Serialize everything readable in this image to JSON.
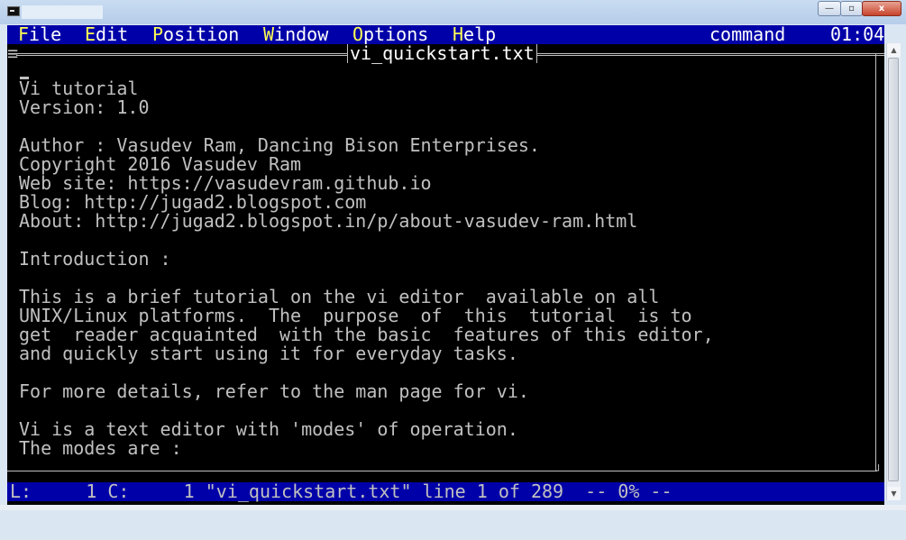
{
  "window": {
    "minimize_glyph": "—",
    "maximize_glyph": "▫",
    "close_glyph": "x"
  },
  "menubar": {
    "items": [
      {
        "hot": "F",
        "rest": "ile"
      },
      {
        "hot": "E",
        "rest": "dit"
      },
      {
        "hot": "P",
        "rest": "osition"
      },
      {
        "hot": "W",
        "rest": "indow"
      },
      {
        "hot": "O",
        "rest": "ptions"
      },
      {
        "hot": "H",
        "rest": "elp"
      }
    ],
    "mode": "command",
    "time": "01:04"
  },
  "editor": {
    "close_glyph": "≡",
    "file_title": "vi_quickstart.txt",
    "lines": [
      "Vi tutorial",
      "Version: 1.0",
      "",
      "Author : Vasudev Ram, Dancing Bison Enterprises.",
      "Copyright 2016 Vasudev Ram",
      "Web site: https://vasudevram.github.io",
      "Blog: http://jugad2.blogspot.com",
      "About: http://jugad2.blogspot.in/p/about-vasudev-ram.html",
      "",
      "Introduction :",
      "",
      "This is a brief tutorial on the vi editor  available on all",
      "UNIX/Linux platforms.  The  purpose  of  this  tutorial  is to",
      "get  reader acquainted  with the basic  features of this editor,",
      "and quickly start using it for everyday tasks.",
      "",
      "For more details, refer to the man page for vi.",
      "",
      "Vi is a text editor with 'modes' of operation.",
      "The modes are :"
    ],
    "corner_glyph": "┘"
  },
  "statusbar": {
    "text": "L:     1 C:     1 \"vi_quickstart.txt\" line 1 of 289  -- 0% --"
  },
  "scrollbar": {
    "up_glyph": "▲",
    "down_glyph": "▼"
  }
}
